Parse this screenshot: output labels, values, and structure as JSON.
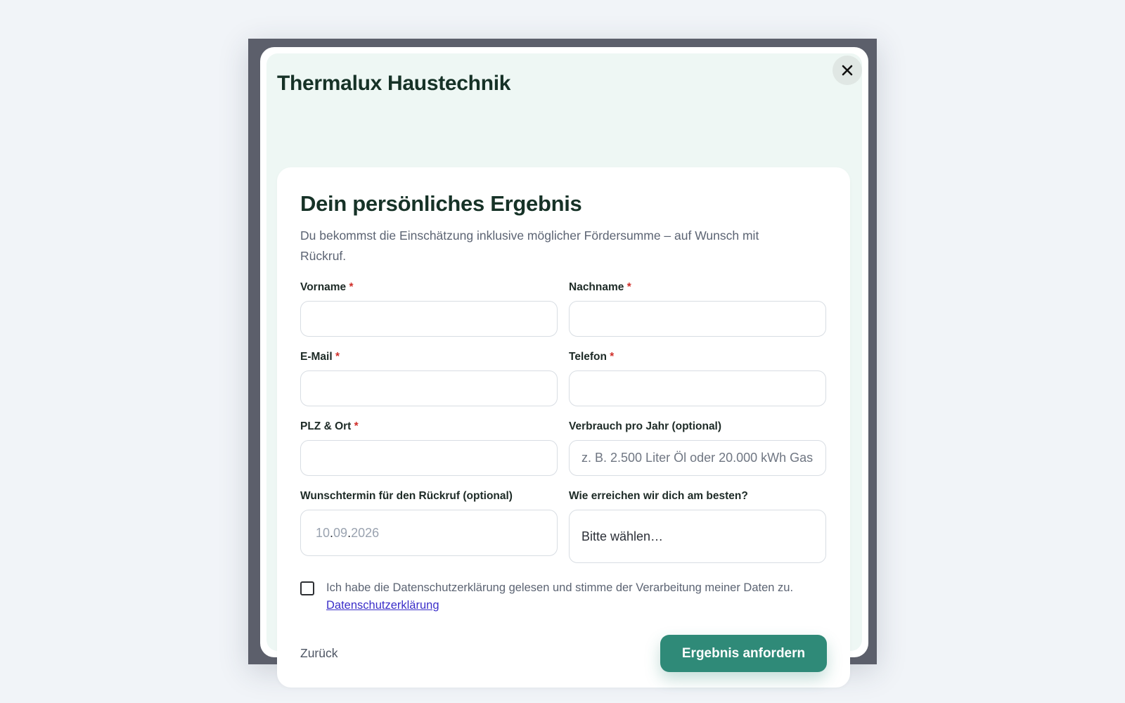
{
  "brand": {
    "name": "Thermalux Haustechnik"
  },
  "close": {
    "symbol": "✕"
  },
  "card": {
    "title": "Dein persönliches Ergebnis",
    "description": "Du bekommst die Einschätzung inklusive möglicher Fördersumme – auf Wunsch mit Rückruf."
  },
  "fields": {
    "first_name": {
      "label": "Vorname",
      "required_mark": "*",
      "value": "",
      "placeholder": ""
    },
    "last_name": {
      "label": "Nachname",
      "required_mark": "*",
      "value": "",
      "placeholder": ""
    },
    "email": {
      "label": "E-Mail",
      "required_mark": "*",
      "value": "",
      "placeholder": ""
    },
    "phone": {
      "label": "Telefon",
      "required_mark": "*",
      "value": "",
      "placeholder": ""
    },
    "zip_city": {
      "label": "PLZ & Ort",
      "required_mark": "*",
      "value": "",
      "placeholder": ""
    },
    "consumption": {
      "label": "Verbrauch pro Jahr (optional)",
      "value": "",
      "placeholder": "z. B. 2.500 Liter Öl oder 20.000 kWh Gas"
    },
    "callback_date": {
      "label": "Wunschtermin für den Rückruf (optional)",
      "day": "10",
      "month": "09",
      "year": "2026",
      "sep": "."
    },
    "contact_method": {
      "label": "Wie erreichen wir dich am besten?",
      "selected": "Bitte wählen…"
    }
  },
  "consent": {
    "text": "Ich habe die Datenschutzerklärung gelesen und stimme der Verarbeitung meiner Daten zu.",
    "link_label": "Datenschutzerklärung",
    "checked": false
  },
  "actions": {
    "back_label": "Zurück",
    "submit_label": "Ergebnis anfordern"
  },
  "colors": {
    "accent": "#2f8a78",
    "required": "#d0302b",
    "link": "#3b2fc9",
    "heading": "#163227"
  }
}
